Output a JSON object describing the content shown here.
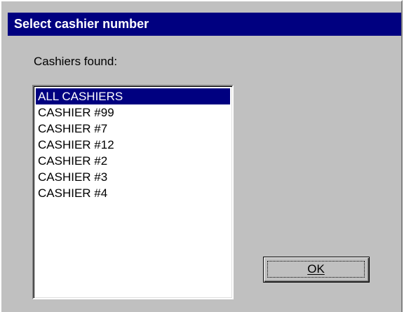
{
  "dialog": {
    "title": "Select cashier number",
    "prompt": "Cashiers found:",
    "cashiers": {
      "items": [
        {
          "label": "ALL CASHIERS",
          "selected": true
        },
        {
          "label": "CASHIER #99",
          "selected": false
        },
        {
          "label": "CASHIER #7",
          "selected": false
        },
        {
          "label": "CASHIER #12",
          "selected": false
        },
        {
          "label": "CASHIER #2",
          "selected": false
        },
        {
          "label": "CASHIER #3",
          "selected": false
        },
        {
          "label": "CASHIER #4",
          "selected": false
        }
      ]
    },
    "ok_label": "OK"
  },
  "colors": {
    "title_bar": "#000080",
    "face": "#c0c0c0",
    "selection": "#000080"
  }
}
